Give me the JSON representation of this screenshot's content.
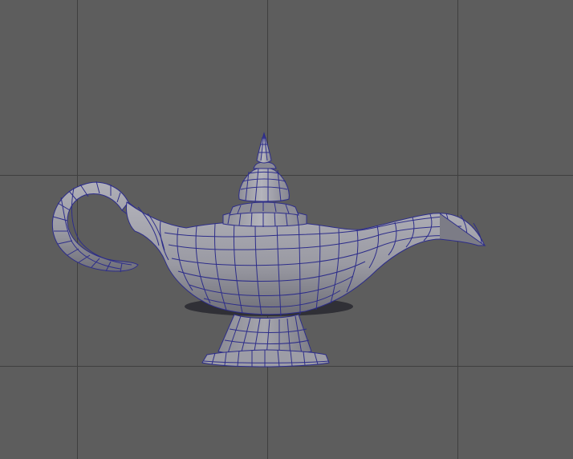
{
  "viewport": {
    "background": "#5d5d5d",
    "grid_color": "#3f3f3f",
    "wire_color": "#2b2b8c",
    "shade_light": "#a3a3ab",
    "shade_mid": "#8d8d96",
    "shade_dark": "#6e6e78"
  },
  "model": {
    "name": "oil-lamp",
    "display": "wireframe-on-shaded"
  }
}
